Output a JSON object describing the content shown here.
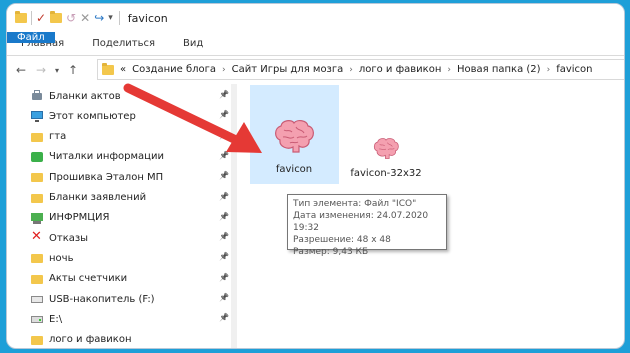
{
  "window": {
    "title": "favicon"
  },
  "ribbon": {
    "tabs": [
      "Файл",
      "Главная",
      "Поделиться",
      "Вид"
    ]
  },
  "address": {
    "chevron": "«",
    "crumbs": [
      "Создание блога",
      "Сайт Игры для мозга",
      "лого и фавикон",
      "Новая папка (2)",
      "favicon"
    ]
  },
  "sidebar": {
    "items": [
      {
        "label": "Бланки актов",
        "icon": "printer-icon",
        "pinned": true
      },
      {
        "label": "Этот компьютер",
        "icon": "computer-icon",
        "pinned": true
      },
      {
        "label": "гта",
        "icon": "folder-icon",
        "pinned": true
      },
      {
        "label": "Читалки информации",
        "icon": "green-app-icon",
        "pinned": true
      },
      {
        "label": "Прошивка Эталон МП",
        "icon": "folder-icon",
        "pinned": true
      },
      {
        "label": "Бланки заявлений",
        "icon": "folder-icon",
        "pinned": true
      },
      {
        "label": "ИНФРМЦИЯ",
        "icon": "network-folder-icon",
        "pinned": true
      },
      {
        "label": "Отказы",
        "icon": "red-x-icon",
        "pinned": true
      },
      {
        "label": "ночь",
        "icon": "folder-icon",
        "pinned": true
      },
      {
        "label": "Акты счетчики",
        "icon": "folder-icon",
        "pinned": true
      },
      {
        "label": "USB-накопитель (F:)",
        "icon": "usb-drive-icon",
        "pinned": true
      },
      {
        "label": "E:\\",
        "icon": "drive-icon",
        "pinned": true
      },
      {
        "label": "лого и фавикон",
        "icon": "folder-icon",
        "pinned": false
      }
    ]
  },
  "files": [
    {
      "name": "favicon",
      "icon": "brain-icon",
      "selected": true
    },
    {
      "name": "favicon-32x32",
      "icon": "brain-icon",
      "selected": false
    }
  ],
  "tooltip": {
    "lines": [
      "Тип элемента: Файл \"ICO\"",
      "Дата изменения: 24.07.2020 19:32",
      "Разрешение: 48 x 48",
      "Размер: 9,43 КБ"
    ]
  },
  "colors": {
    "accent": "#1979ca",
    "selection": "#cce8ff",
    "arrow": "#e53935",
    "background": "#1e9fd8"
  }
}
